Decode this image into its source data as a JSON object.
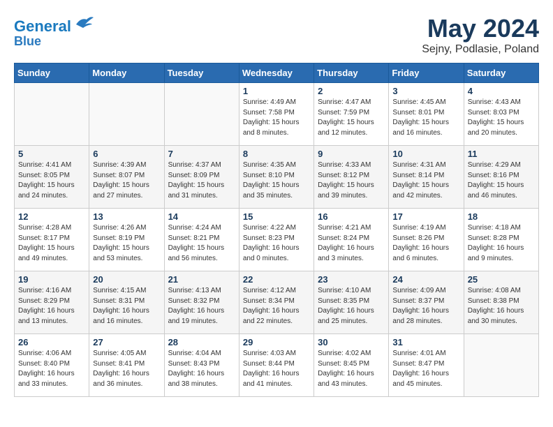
{
  "header": {
    "logo_line1": "General",
    "logo_line2": "Blue",
    "month_title": "May 2024",
    "subtitle": "Sejny, Podlasie, Poland"
  },
  "days_of_week": [
    "Sunday",
    "Monday",
    "Tuesday",
    "Wednesday",
    "Thursday",
    "Friday",
    "Saturday"
  ],
  "weeks": [
    [
      {
        "day": "",
        "info": ""
      },
      {
        "day": "",
        "info": ""
      },
      {
        "day": "",
        "info": ""
      },
      {
        "day": "1",
        "info": "Sunrise: 4:49 AM\nSunset: 7:58 PM\nDaylight: 15 hours\nand 8 minutes."
      },
      {
        "day": "2",
        "info": "Sunrise: 4:47 AM\nSunset: 7:59 PM\nDaylight: 15 hours\nand 12 minutes."
      },
      {
        "day": "3",
        "info": "Sunrise: 4:45 AM\nSunset: 8:01 PM\nDaylight: 15 hours\nand 16 minutes."
      },
      {
        "day": "4",
        "info": "Sunrise: 4:43 AM\nSunset: 8:03 PM\nDaylight: 15 hours\nand 20 minutes."
      }
    ],
    [
      {
        "day": "5",
        "info": "Sunrise: 4:41 AM\nSunset: 8:05 PM\nDaylight: 15 hours\nand 24 minutes."
      },
      {
        "day": "6",
        "info": "Sunrise: 4:39 AM\nSunset: 8:07 PM\nDaylight: 15 hours\nand 27 minutes."
      },
      {
        "day": "7",
        "info": "Sunrise: 4:37 AM\nSunset: 8:09 PM\nDaylight: 15 hours\nand 31 minutes."
      },
      {
        "day": "8",
        "info": "Sunrise: 4:35 AM\nSunset: 8:10 PM\nDaylight: 15 hours\nand 35 minutes."
      },
      {
        "day": "9",
        "info": "Sunrise: 4:33 AM\nSunset: 8:12 PM\nDaylight: 15 hours\nand 39 minutes."
      },
      {
        "day": "10",
        "info": "Sunrise: 4:31 AM\nSunset: 8:14 PM\nDaylight: 15 hours\nand 42 minutes."
      },
      {
        "day": "11",
        "info": "Sunrise: 4:29 AM\nSunset: 8:16 PM\nDaylight: 15 hours\nand 46 minutes."
      }
    ],
    [
      {
        "day": "12",
        "info": "Sunrise: 4:28 AM\nSunset: 8:17 PM\nDaylight: 15 hours\nand 49 minutes."
      },
      {
        "day": "13",
        "info": "Sunrise: 4:26 AM\nSunset: 8:19 PM\nDaylight: 15 hours\nand 53 minutes."
      },
      {
        "day": "14",
        "info": "Sunrise: 4:24 AM\nSunset: 8:21 PM\nDaylight: 15 hours\nand 56 minutes."
      },
      {
        "day": "15",
        "info": "Sunrise: 4:22 AM\nSunset: 8:23 PM\nDaylight: 16 hours\nand 0 minutes."
      },
      {
        "day": "16",
        "info": "Sunrise: 4:21 AM\nSunset: 8:24 PM\nDaylight: 16 hours\nand 3 minutes."
      },
      {
        "day": "17",
        "info": "Sunrise: 4:19 AM\nSunset: 8:26 PM\nDaylight: 16 hours\nand 6 minutes."
      },
      {
        "day": "18",
        "info": "Sunrise: 4:18 AM\nSunset: 8:28 PM\nDaylight: 16 hours\nand 9 minutes."
      }
    ],
    [
      {
        "day": "19",
        "info": "Sunrise: 4:16 AM\nSunset: 8:29 PM\nDaylight: 16 hours\nand 13 minutes."
      },
      {
        "day": "20",
        "info": "Sunrise: 4:15 AM\nSunset: 8:31 PM\nDaylight: 16 hours\nand 16 minutes."
      },
      {
        "day": "21",
        "info": "Sunrise: 4:13 AM\nSunset: 8:32 PM\nDaylight: 16 hours\nand 19 minutes."
      },
      {
        "day": "22",
        "info": "Sunrise: 4:12 AM\nSunset: 8:34 PM\nDaylight: 16 hours\nand 22 minutes."
      },
      {
        "day": "23",
        "info": "Sunrise: 4:10 AM\nSunset: 8:35 PM\nDaylight: 16 hours\nand 25 minutes."
      },
      {
        "day": "24",
        "info": "Sunrise: 4:09 AM\nSunset: 8:37 PM\nDaylight: 16 hours\nand 28 minutes."
      },
      {
        "day": "25",
        "info": "Sunrise: 4:08 AM\nSunset: 8:38 PM\nDaylight: 16 hours\nand 30 minutes."
      }
    ],
    [
      {
        "day": "26",
        "info": "Sunrise: 4:06 AM\nSunset: 8:40 PM\nDaylight: 16 hours\nand 33 minutes."
      },
      {
        "day": "27",
        "info": "Sunrise: 4:05 AM\nSunset: 8:41 PM\nDaylight: 16 hours\nand 36 minutes."
      },
      {
        "day": "28",
        "info": "Sunrise: 4:04 AM\nSunset: 8:43 PM\nDaylight: 16 hours\nand 38 minutes."
      },
      {
        "day": "29",
        "info": "Sunrise: 4:03 AM\nSunset: 8:44 PM\nDaylight: 16 hours\nand 41 minutes."
      },
      {
        "day": "30",
        "info": "Sunrise: 4:02 AM\nSunset: 8:45 PM\nDaylight: 16 hours\nand 43 minutes."
      },
      {
        "day": "31",
        "info": "Sunrise: 4:01 AM\nSunset: 8:47 PM\nDaylight: 16 hours\nand 45 minutes."
      },
      {
        "day": "",
        "info": ""
      }
    ]
  ]
}
